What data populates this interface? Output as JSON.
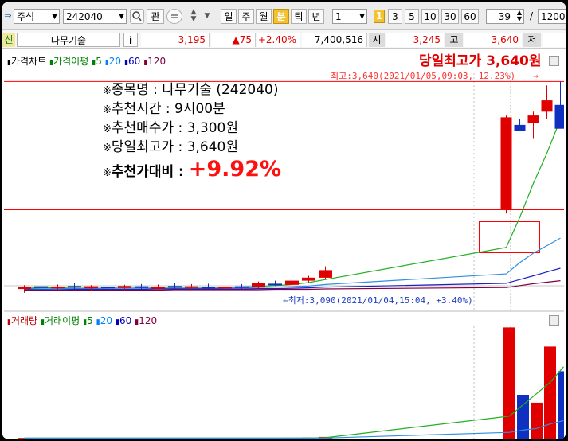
{
  "toolbar": {
    "market": "주식",
    "code": "242040",
    "search_label": "관",
    "periods": [
      "일",
      "주",
      "월",
      "분",
      "틱",
      "년"
    ],
    "active_period": "분",
    "interval": "1",
    "quick_intervals": [
      "3",
      "5",
      "10",
      "30",
      "60"
    ],
    "count": "39",
    "slash": "/",
    "total": "1200"
  },
  "info": {
    "tag": "신",
    "name": "나무기술",
    "i_label": "i",
    "price": "3,195",
    "change": "▲75",
    "change_pct": "+2.40%",
    "volume": "7,400,516",
    "open_label": "시",
    "open": "3,245",
    "high_label": "고",
    "high": "3,640",
    "low_label": "저"
  },
  "price_panel": {
    "legend": [
      {
        "text": "가격차트",
        "color": "#000000"
      },
      {
        "text": "가격이평",
        "color": "#008000"
      },
      {
        "text": "5",
        "color": "#008000"
      },
      {
        "text": "20",
        "color": "#0080ff"
      },
      {
        "text": "60",
        "color": "#0000c0"
      },
      {
        "text": "120",
        "color": "#800040"
      }
    ],
    "headline": "당일최고가 3,640원",
    "max_label": "최고:3,640(2021/01/05,09:03,  12.23%)",
    "max_arrow": "→",
    "min_label": "←최저:3,090(2021/01/04,15:04, +3.40%)"
  },
  "notes": [
    {
      "prefix": "※",
      "label": "종목명",
      "sep": " : ",
      "value": "나무기술 (242040)"
    },
    {
      "prefix": "※",
      "label": "추천시간",
      "sep": " : ",
      "value": "9시00분"
    },
    {
      "prefix": "※",
      "label": "추천매수가",
      "sep": " : ",
      "value": "3,300원"
    },
    {
      "prefix": "※",
      "label": "당일최고가",
      "sep": " : ",
      "value": "3,640원"
    }
  ],
  "highlight": {
    "prefix": "※",
    "label": "추천가대비",
    "sep": " : ",
    "value": "+9.92%"
  },
  "volume_panel": {
    "legend": [
      {
        "text": "거래량",
        "color": "#c00000"
      },
      {
        "text": "거래이평",
        "color": "#008000"
      },
      {
        "text": "5",
        "color": "#008000"
      },
      {
        "text": "20",
        "color": "#0080ff"
      },
      {
        "text": "60",
        "color": "#0000c0"
      },
      {
        "text": "120",
        "color": "#800040"
      }
    ]
  },
  "colors": {
    "up": "#e00000",
    "down": "#1030c0",
    "ma5": "#20b020",
    "ma20": "#3090e0",
    "ma60": "#2020c0",
    "ma120": "#800040",
    "annotation": "#ff0000"
  },
  "chart_data": [
    {
      "type": "candlestick",
      "y_unit": "KRW",
      "ylim": [
        3050,
        3700
      ],
      "reference_lines": [
        3640,
        3300
      ],
      "candles": [
        {
          "open": 3090,
          "high": 3100,
          "low": 3080,
          "close": 3095,
          "dir": "up"
        },
        {
          "open": 3097,
          "high": 3105,
          "low": 3090,
          "close": 3093,
          "dir": "down"
        },
        {
          "open": 3094,
          "high": 3102,
          "low": 3088,
          "close": 3096,
          "dir": "up"
        },
        {
          "open": 3098,
          "high": 3106,
          "low": 3090,
          "close": 3094,
          "dir": "down"
        },
        {
          "open": 3092,
          "high": 3100,
          "low": 3085,
          "close": 3097,
          "dir": "up"
        },
        {
          "open": 3096,
          "high": 3104,
          "low": 3089,
          "close": 3092,
          "dir": "down"
        },
        {
          "open": 3093,
          "high": 3101,
          "low": 3087,
          "close": 3098,
          "dir": "up"
        },
        {
          "open": 3097,
          "high": 3103,
          "low": 3090,
          "close": 3093,
          "dir": "down"
        },
        {
          "open": 3094,
          "high": 3102,
          "low": 3088,
          "close": 3095,
          "dir": "up"
        },
        {
          "open": 3098,
          "high": 3105,
          "low": 3091,
          "close": 3094,
          "dir": "down"
        },
        {
          "open": 3095,
          "high": 3103,
          "low": 3089,
          "close": 3097,
          "dir": "up"
        },
        {
          "open": 3096,
          "high": 3104,
          "low": 3090,
          "close": 3093,
          "dir": "down"
        },
        {
          "open": 3094,
          "high": 3101,
          "low": 3088,
          "close": 3096,
          "dir": "up"
        },
        {
          "open": 3097,
          "high": 3103,
          "low": 3090,
          "close": 3095,
          "dir": "down"
        },
        {
          "open": 3096,
          "high": 3110,
          "low": 3092,
          "close": 3105,
          "dir": "up"
        },
        {
          "open": 3104,
          "high": 3112,
          "low": 3098,
          "close": 3100,
          "dir": "down"
        },
        {
          "open": 3101,
          "high": 3118,
          "low": 3099,
          "close": 3112,
          "dir": "up"
        },
        {
          "open": 3112,
          "high": 3125,
          "low": 3108,
          "close": 3120,
          "dir": "up"
        },
        {
          "open": 3120,
          "high": 3150,
          "low": 3115,
          "close": 3140,
          "dir": "up"
        },
        {
          "open": 3300,
          "high": 3550,
          "low": 3290,
          "close": 3545,
          "dir": "up"
        },
        {
          "open": 3525,
          "high": 3540,
          "low": 3510,
          "close": 3508,
          "dir": "down"
        },
        {
          "open": 3530,
          "high": 3560,
          "low": 3490,
          "close": 3550,
          "dir": "up"
        },
        {
          "open": 3560,
          "high": 3630,
          "low": 3540,
          "close": 3590,
          "dir": "up"
        },
        {
          "open": 3578,
          "high": 3640,
          "low": 3530,
          "close": 3515,
          "dir": "down"
        }
      ],
      "moving_averages": {
        "5": [
          3092,
          3093,
          3094,
          3094,
          3095,
          3095,
          3095,
          3095,
          3095,
          3095,
          3095,
          3095,
          3095,
          3095,
          3097,
          3099,
          3102,
          3107,
          3115,
          3200,
          3280,
          3370,
          3450,
          3540
        ],
        "20": [
          3090,
          3090,
          3091,
          3091,
          3091,
          3092,
          3092,
          3092,
          3092,
          3092,
          3092,
          3092,
          3093,
          3093,
          3094,
          3095,
          3096,
          3098,
          3102,
          3130,
          3160,
          3185,
          3205,
          3225
        ],
        "60": [
          3088,
          3088,
          3088,
          3089,
          3089,
          3089,
          3089,
          3089,
          3090,
          3090,
          3090,
          3090,
          3090,
          3090,
          3091,
          3091,
          3092,
          3093,
          3095,
          3105,
          3115,
          3125,
          3135,
          3145
        ],
        "120": [
          3086,
          3086,
          3086,
          3087,
          3087,
          3087,
          3087,
          3087,
          3087,
          3088,
          3088,
          3088,
          3088,
          3088,
          3088,
          3089,
          3089,
          3089,
          3090,
          3094,
          3099,
          3104,
          3108,
          3112
        ]
      }
    },
    {
      "type": "bar",
      "y_unit": "shares",
      "ylim": [
        0,
        1000000
      ],
      "values": [
        6000,
        3000,
        5000,
        3000,
        6000,
        2000,
        5000,
        4000,
        3000,
        5000,
        4000,
        2000,
        5000,
        3000,
        6000,
        4000,
        8000,
        10000,
        15000,
        990000,
        390000,
        320000,
        820000,
        600000
      ],
      "dirs": [
        "up",
        "down",
        "up",
        "down",
        "up",
        "down",
        "up",
        "down",
        "up",
        "down",
        "up",
        "down",
        "up",
        "down",
        "up",
        "down",
        "up",
        "up",
        "up",
        "up",
        "down",
        "up",
        "up",
        "down"
      ],
      "moving_averages": {
        "5": [
          4000,
          4000,
          4000,
          4000,
          4000,
          4000,
          4000,
          4000,
          4000,
          4000,
          4000,
          4000,
          4000,
          4000,
          4000,
          4000,
          5000,
          6000,
          8000,
          200000,
          300000,
          400000,
          500000,
          640000
        ],
        "20": [
          4000,
          4000,
          4000,
          4000,
          4000,
          4000,
          4000,
          4000,
          4000,
          4000,
          4000,
          4000,
          4000,
          4000,
          4000,
          4000,
          4000,
          4000,
          5000,
          55000,
          75000,
          90000,
          130000,
          160000
        ]
      }
    }
  ]
}
